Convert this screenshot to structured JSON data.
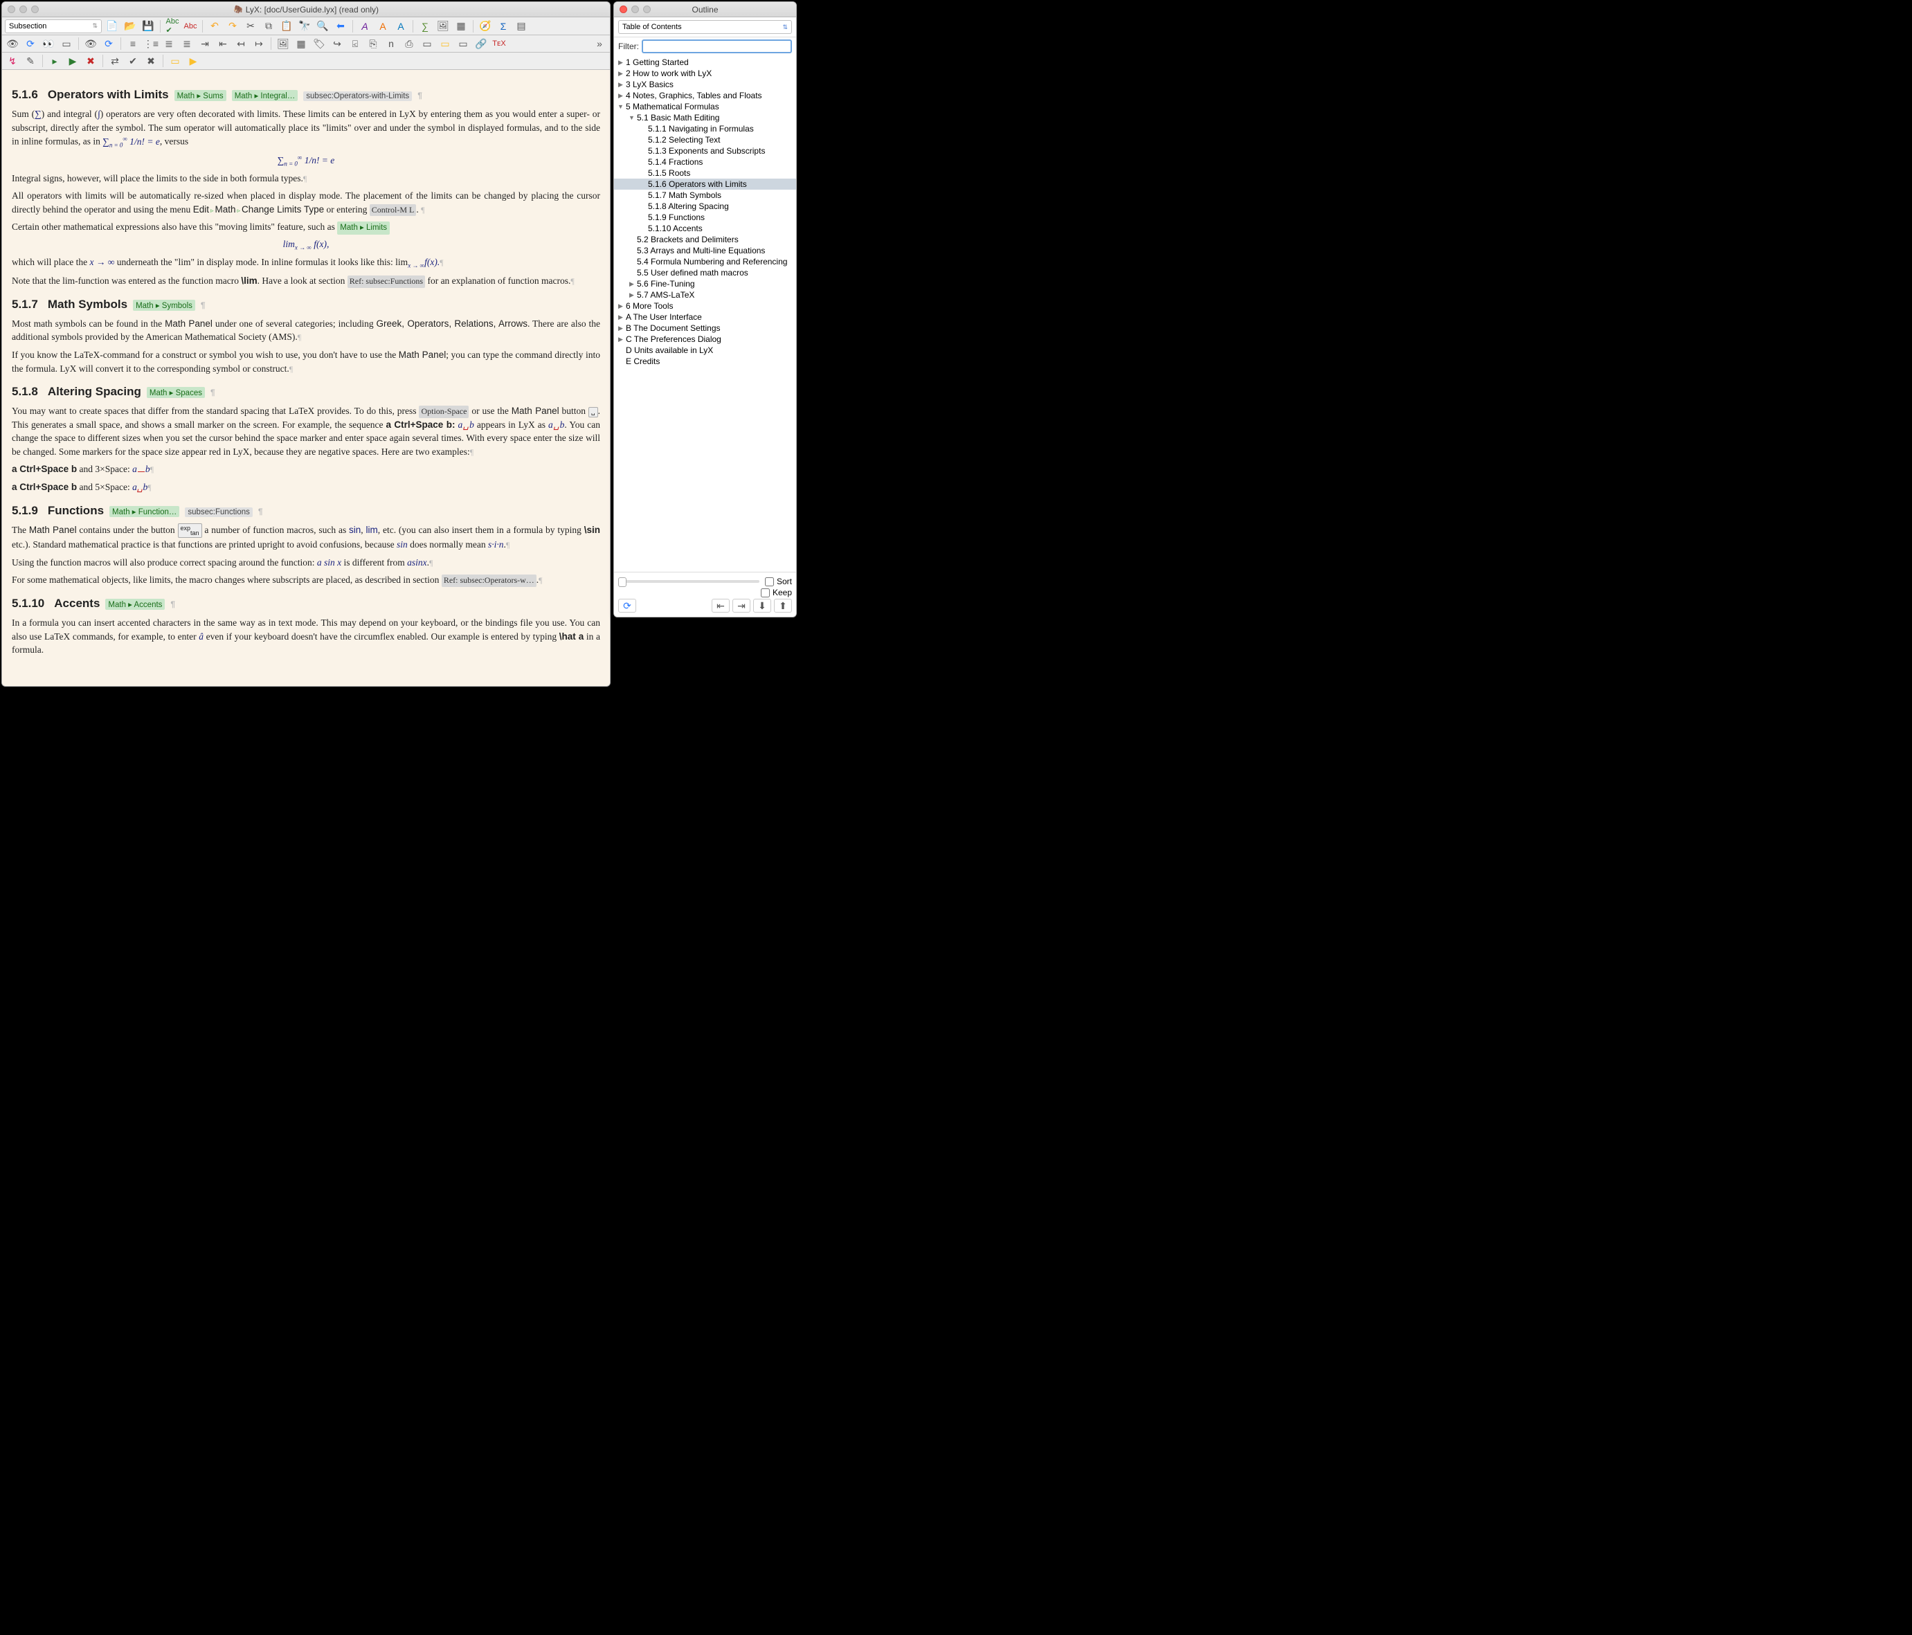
{
  "main_window": {
    "title": "LyX: [doc/UserGuide.lyx] (read only)",
    "para_select": "Subsection"
  },
  "doc": {
    "s516": {
      "num": "5.1.6",
      "title": "Operators with Limits",
      "ref1": "Math ▸ Sums",
      "ref2": "Math ▸ Integral…",
      "label": "subsec:Operators-with-Limits",
      "p1a": "Sum (",
      "p1b": ") and integral (",
      "p1c": ") operators are very often decorated with limits. These limits can be entered in LyX by entering them as you would enter a super- or subscript, directly after the symbol. The sum operator will automatically place its \"limits\" over and under the symbol in displayed formulas, and to the side in inline formulas, as in ",
      "p1d": ", versus",
      "eq1": "∑",
      "p2": "Integral signs, however, will place the limits to the side in both formula types.",
      "p3a": "All operators with limits will be automatically re-sized when placed in display mode. The placement of the limits can be changed by placing the cursor directly behind the operator and using the menu ",
      "menu_edit": "Edit",
      "menu_math": "Math",
      "menu_change": "Change Limits Type",
      "p3b": " or entering ",
      "short": "Control-M L",
      "p4a": "Certain other mathematical expressions also have this \"moving limits\" feature, such as ",
      "ref3": "Math ▸ Limits",
      "eq2a": "lim",
      "eq2b": "f(x),",
      "p5a": "which will place the ",
      "p5b": " underneath the \"lim\" in display mode. In inline formulas it looks like this:  lim",
      "p5c": "f(x).",
      "p6a": "Note that the lim-function was entered as the function macro ",
      "p6cmd": "\\lim",
      "p6b": ". Have a look at section",
      "ref4": "Ref: subsec:Functions",
      "p6c": " for an explanation of function macros."
    },
    "s517": {
      "num": "5.1.7",
      "title": "Math Symbols",
      "ref1": "Math ▸ Symbols",
      "p1a": "Most math symbols can be found in the ",
      "panel": "Math Panel",
      "p1b": " under one of several categories; including ",
      "cats": "Greek, Operators, Relations, Arrows",
      "p1c": ". There are also the additional symbols provided by the American Mathematical Society (AMS).",
      "p2a": "If you know the LaTeX-command for a construct or symbol you wish to use, you don't have to use the ",
      "p2b": "; you can type the command directly into the formula. LyX will convert it to the corresponding symbol or construct."
    },
    "s518": {
      "num": "5.1.8",
      "title": "Altering Spacing",
      "ref1": "Math ▸ Spaces",
      "p1a": "You may want to create spaces that differ from the standard spacing that LaTeX provides. To do this, press ",
      "key1": "Option-Space",
      "p1b": " or use the ",
      "panel": "Math Panel",
      "p1c": " button ",
      "p1d": ". This generates a small space, and shows a small marker on the screen. For example, the sequence ",
      "seq1": "a Ctrl+Space b:",
      "pair1": "a␣b",
      "p1e": " appears in LyX as ",
      "p1f": ". You can change the space to different sizes when you set the cursor behind the space marker and enter space again several times. With every space enter the size will be changed. Some markers for the space size appear red in LyX, because they are negative spaces. Here are two examples:",
      "ex1a": "a Ctrl+Space b",
      "ex1b": " and 3×Space: ",
      "ex2a": "a Ctrl+Space b",
      "ex2b": " and 5×Space: "
    },
    "s519": {
      "num": "5.1.9",
      "title": "Functions",
      "ref1": "Math ▸ Function…",
      "label": "subsec:Functions",
      "p1a": "The ",
      "panel": "Math Panel",
      "p1b": " contains under the button ",
      "p1c": " a number of function macros, such as ",
      "fns": "sin, lim",
      "p1d": ", etc. (you can also insert them in a formula by typing ",
      "cmd": "\\sin",
      "p1e": " etc.). Standard mathematical practice is that functions are printed upright to avoid confusions, because ",
      "p1f": " does normally mean ",
      "p1g": ".",
      "p2a": "Using the function macros will also produce correct spacing around the function: ",
      "p2b": " is different from ",
      "p2c": ".",
      "p3a": "For some mathematical objects, like limits, the macro changes where subscripts are placed, as described in section",
      "ref2": "Ref: subsec:Operators-w…"
    },
    "s5110": {
      "num": "5.1.10",
      "title": "Accents",
      "ref1": "Math ▸ Accents",
      "p1a": "In a formula you can insert accented characters in the same way as in text mode. This may depend on your keyboard, or the bindings file you use. You can also use LaTeX commands, for example, to enter ",
      "p1b": " even if your keyboard doesn't have the circumflex enabled. Our example is entered by typing ",
      "cmd": "\\hat a",
      "p1c": " in a formula."
    }
  },
  "outline": {
    "title": "Outline",
    "combo": "Table of Contents",
    "filter_label": "Filter:",
    "sort": "Sort",
    "keep": "Keep",
    "items": [
      {
        "d": 0,
        "t": "r",
        "l": "1 Getting Started"
      },
      {
        "d": 0,
        "t": "r",
        "l": "2 How to work with LyX"
      },
      {
        "d": 0,
        "t": "r",
        "l": "3 LyX Basics"
      },
      {
        "d": 0,
        "t": "r",
        "l": "4 Notes, Graphics, Tables and Floats"
      },
      {
        "d": 0,
        "t": "d",
        "l": "5 Mathematical Formulas"
      },
      {
        "d": 1,
        "t": "d",
        "l": "5.1 Basic Math Editing"
      },
      {
        "d": 2,
        "t": "n",
        "l": "5.1.1 Navigating in Formulas"
      },
      {
        "d": 2,
        "t": "n",
        "l": "5.1.2 Selecting Text"
      },
      {
        "d": 2,
        "t": "n",
        "l": "5.1.3 Exponents and Subscripts"
      },
      {
        "d": 2,
        "t": "n",
        "l": "5.1.4 Fractions"
      },
      {
        "d": 2,
        "t": "n",
        "l": "5.1.5 Roots"
      },
      {
        "d": 2,
        "t": "n",
        "l": "5.1.6 Operators with Limits",
        "sel": true
      },
      {
        "d": 2,
        "t": "n",
        "l": "5.1.7 Math Symbols"
      },
      {
        "d": 2,
        "t": "n",
        "l": "5.1.8 Altering Spacing"
      },
      {
        "d": 2,
        "t": "n",
        "l": "5.1.9 Functions"
      },
      {
        "d": 2,
        "t": "n",
        "l": "5.1.10 Accents"
      },
      {
        "d": 1,
        "t": "n",
        "l": "5.2 Brackets and Delimiters"
      },
      {
        "d": 1,
        "t": "n",
        "l": "5.3 Arrays and Multi-line Equations"
      },
      {
        "d": 1,
        "t": "n",
        "l": "5.4 Formula Numbering and Referencing"
      },
      {
        "d": 1,
        "t": "n",
        "l": "5.5 User defined math macros"
      },
      {
        "d": 1,
        "t": "r",
        "l": "5.6 Fine-Tuning"
      },
      {
        "d": 1,
        "t": "r",
        "l": "5.7 AMS-LaTeX"
      },
      {
        "d": 0,
        "t": "r",
        "l": "6 More Tools"
      },
      {
        "d": 0,
        "t": "r",
        "l": "A The User Interface"
      },
      {
        "d": 0,
        "t": "r",
        "l": "B The Document Settings"
      },
      {
        "d": 0,
        "t": "r",
        "l": "C The Preferences Dialog"
      },
      {
        "d": 0,
        "t": "n",
        "l": "D Units available in LyX"
      },
      {
        "d": 0,
        "t": "n",
        "l": "E Credits"
      }
    ]
  }
}
